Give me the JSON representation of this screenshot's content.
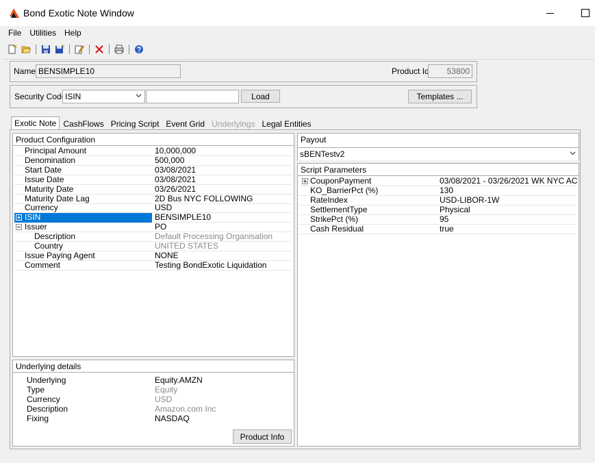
{
  "window": {
    "title": "Bond Exotic Note Window"
  },
  "menu": [
    "File",
    "Utilities",
    "Help"
  ],
  "toolbar": [
    "new-icon",
    "open-icon",
    "save-icon",
    "save-as-icon",
    "edit-icon",
    "delete-icon",
    "print-icon",
    "help-icon"
  ],
  "header": {
    "name_label": "Name",
    "name_value": "BENSIMPLE10",
    "product_id_label": "Product Id",
    "product_id_value": "53800",
    "security_code_label": "Security Code",
    "security_code_type": "ISIN",
    "security_code_value": "",
    "load_label": "Load",
    "templates_label": "Templates ..."
  },
  "tabs": [
    {
      "label": "Exotic Note",
      "state": "active"
    },
    {
      "label": "CashFlows",
      "state": "normal"
    },
    {
      "label": "Pricing Script",
      "state": "normal"
    },
    {
      "label": "Event Grid",
      "state": "normal"
    },
    {
      "label": "Underlyings",
      "state": "disabled"
    },
    {
      "label": "Legal Entities",
      "state": "normal"
    }
  ],
  "product_config": {
    "title": "Product Configuration",
    "rows": [
      {
        "key": "Principal Amount",
        "value": "10,000,000"
      },
      {
        "key": "Denomination",
        "value": "500,000"
      },
      {
        "key": "Start Date",
        "value": "03/08/2021"
      },
      {
        "key": "Issue Date",
        "value": "03/08/2021"
      },
      {
        "key": "Maturity Date",
        "value": "03/26/2021"
      },
      {
        "key": "Maturity Date Lag",
        "value": "2D Bus NYC FOLLOWING"
      },
      {
        "key": "Currency",
        "value": "USD"
      },
      {
        "key": "ISIN",
        "value": "BENSIMPLE10"
      },
      {
        "key": "Issuer",
        "value": "PO"
      },
      {
        "key": "Description",
        "value": "Default Processing Organisation"
      },
      {
        "key": "Country",
        "value": "UNITED STATES"
      },
      {
        "key": "Issue Paying Agent",
        "value": "NONE"
      },
      {
        "key": "Comment",
        "value": "Testing BondExotic Liquidation"
      }
    ]
  },
  "underlying_details": {
    "title": "Underlying details",
    "rows": [
      {
        "key": "Underlying",
        "value": "Equity.AMZN"
      },
      {
        "key": "Type",
        "value": "Equity"
      },
      {
        "key": "Currency",
        "value": "USD"
      },
      {
        "key": "Description",
        "value": "Amazon.com Inc"
      },
      {
        "key": "Fixing",
        "value": "NASDAQ"
      }
    ],
    "product_info_label": "Product Info"
  },
  "payout": {
    "title": "Payout",
    "selected": "sBENTestv2"
  },
  "script_params": {
    "title": "Script Parameters",
    "rows": [
      {
        "key": "CouponPayment",
        "value": "03/08/2021 - 03/26/2021 WK NYC AC..."
      },
      {
        "key": "KO_BarrierPct (%)",
        "value": "130"
      },
      {
        "key": "RateIndex",
        "value": "USD-LIBOR-1W"
      },
      {
        "key": "SettlementType",
        "value": "Physical"
      },
      {
        "key": "StrikePct (%)",
        "value": "95"
      },
      {
        "key": "Cash Residual",
        "value": "true"
      }
    ]
  },
  "colors": {
    "selection": "#0078d7",
    "logo": "#e8531e"
  }
}
